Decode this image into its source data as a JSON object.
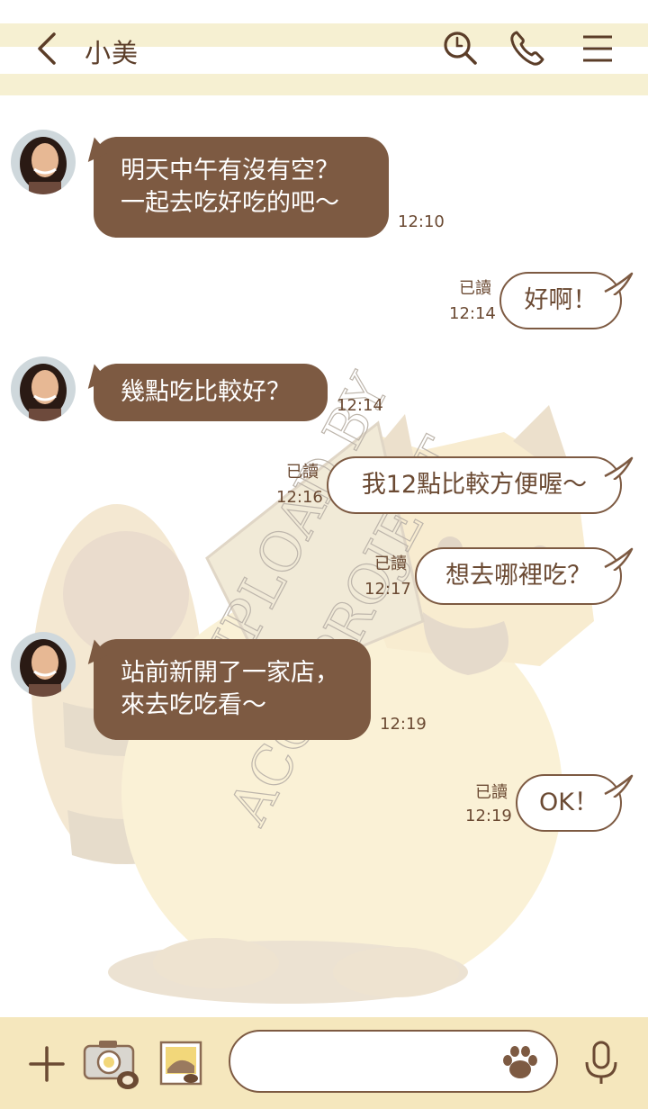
{
  "header": {
    "title": "小美",
    "icons": [
      "back-chevron-icon",
      "search-icon",
      "phone-icon",
      "menu-icon"
    ]
  },
  "watermark": {
    "line1": "UPLOAD BY",
    "line2": "ACCUPROJECT"
  },
  "messages": [
    {
      "side": "in",
      "text": "明天中午有沒有空？\n一起去吃好吃的吧～",
      "time": "12:10"
    },
    {
      "side": "out",
      "text": "好啊！",
      "read": "已讀",
      "time": "12:14"
    },
    {
      "side": "in",
      "text": "幾點吃比較好？",
      "time": "12:14"
    },
    {
      "side": "out",
      "text": "我12點比較方便喔～",
      "read": "已讀",
      "time": "12:16"
    },
    {
      "side": "out",
      "text": "想去哪裡吃？",
      "read": "已讀",
      "time": "12:17"
    },
    {
      "side": "in",
      "text": "站前新開了一家店，\n來去吃吃看～",
      "time": "12:19"
    },
    {
      "side": "out",
      "text": "OK！",
      "read": "已讀",
      "time": "12:19"
    }
  ],
  "input_bar": {
    "message_value": "",
    "icons": [
      "plus-icon",
      "camera-icon",
      "photo-icon",
      "paw-sticker-icon",
      "microphone-icon"
    ]
  },
  "colors": {
    "brown": "#7d5a42",
    "stripe": "#f6f0d2",
    "input_bar": "#f5e7bd"
  }
}
